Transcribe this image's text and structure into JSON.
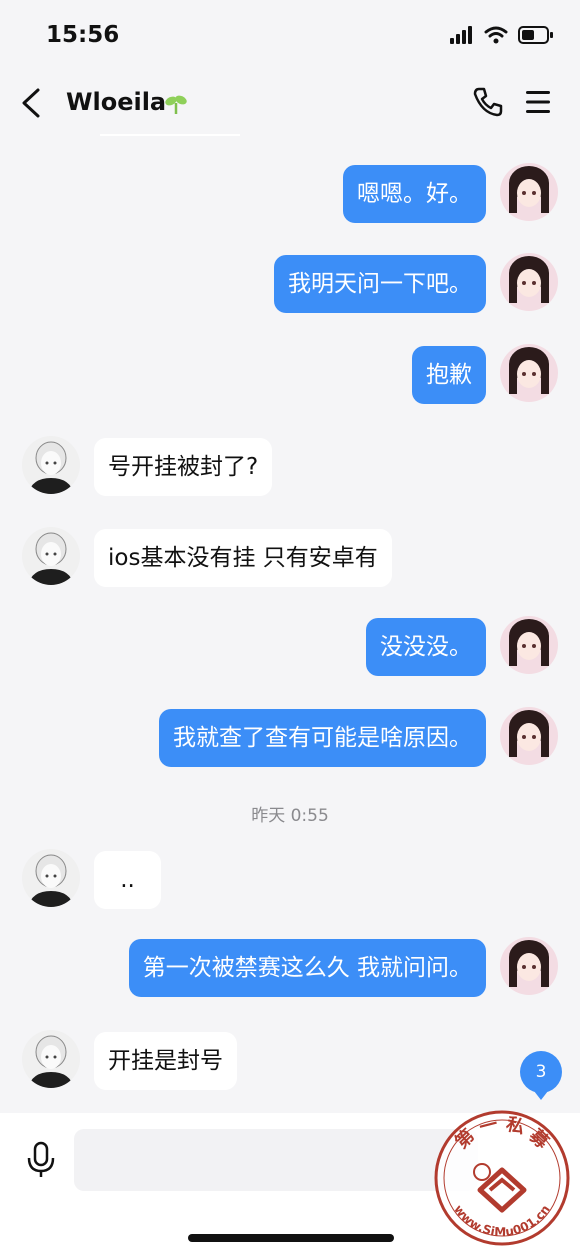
{
  "status": {
    "time": "15:56"
  },
  "header": {
    "name": "Wloeila"
  },
  "messages": [
    {
      "side": "me",
      "text": "嗯嗯。好。"
    },
    {
      "side": "me",
      "text": "我明天问一下吧。"
    },
    {
      "side": "me",
      "text": "抱歉"
    },
    {
      "side": "other",
      "text": "号开挂被封了?"
    },
    {
      "side": "other",
      "text": "ios基本没有挂 只有安卓有"
    },
    {
      "side": "me",
      "text": "没没没。"
    },
    {
      "side": "me",
      "text": "我就查了查有可能是啥原因。"
    },
    {
      "side": "other",
      "text": ".."
    },
    {
      "side": "me",
      "text": "第一次被禁赛这么久 我就问问。"
    },
    {
      "side": "other",
      "text": "开挂是封号"
    }
  ],
  "divider": {
    "time": "昨天 0:55"
  },
  "unread": {
    "count": "3"
  },
  "watermark": {
    "top_text": "第 一 私 募",
    "url": "www.SiMu001.cn"
  },
  "colors": {
    "accent": "#3c8ef7",
    "background": "#f5f5f7"
  }
}
